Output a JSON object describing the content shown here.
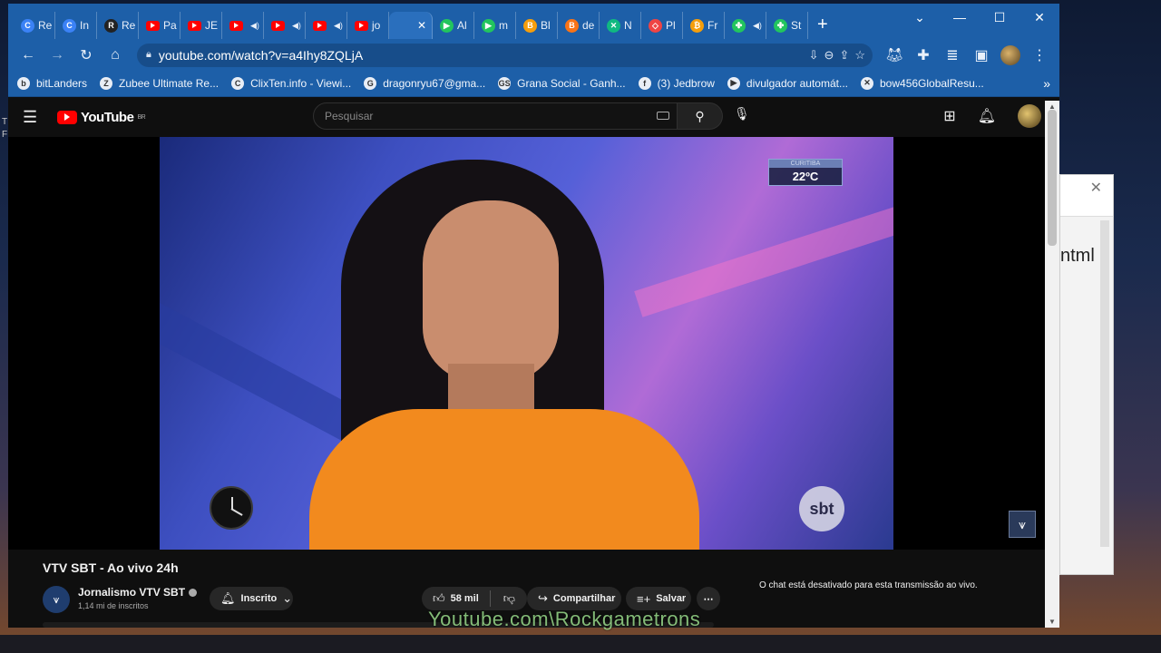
{
  "desktop": {
    "bg_window_text": "ntml",
    "edge_text": "T\nF"
  },
  "tabs": [
    {
      "label": "Re",
      "fav": "C",
      "color": "#3b82f6"
    },
    {
      "label": "In",
      "fav": "C",
      "color": "#3b82f6"
    },
    {
      "label": "Re",
      "fav": "R",
      "color": "#222222"
    },
    {
      "label": "Pa",
      "fav": "yt"
    },
    {
      "label": "JE",
      "fav": "yt"
    },
    {
      "label": "",
      "fav": "yt",
      "audio": true
    },
    {
      "label": "",
      "fav": "yt",
      "audio": true
    },
    {
      "label": "",
      "fav": "yt",
      "audio": true
    },
    {
      "label": "jo",
      "fav": "yt"
    },
    {
      "label": "",
      "fav": "",
      "active": true
    },
    {
      "label": "Al",
      "fav": "▶",
      "color": "#22c55e"
    },
    {
      "label": "m",
      "fav": "▶",
      "color": "#22c55e"
    },
    {
      "label": "Bl",
      "fav": "B",
      "color": "#f59e0b"
    },
    {
      "label": "de",
      "fav": "B",
      "color": "#f97316"
    },
    {
      "label": "N",
      "fav": "✕",
      "color": "#10b981"
    },
    {
      "label": "Pl",
      "fav": "◇",
      "color": "#ef4444"
    },
    {
      "label": "Fr",
      "fav": "₿",
      "color": "#f59e0b"
    },
    {
      "label": "",
      "fav": "✤",
      "color": "#22c55e",
      "audio": true
    },
    {
      "label": "St",
      "fav": "✤",
      "color": "#22c55e"
    }
  ],
  "address": {
    "url": "youtube.com/watch?v=a4Ihy8ZQLjA"
  },
  "bookmarks": [
    {
      "label": "bitLanders",
      "icon": "b"
    },
    {
      "label": "Zubee Ultimate Re...",
      "icon": "Z"
    },
    {
      "label": "ClixTen.info - Viewi...",
      "icon": "C"
    },
    {
      "label": "dragonryu67@gma...",
      "icon": "G"
    },
    {
      "label": "Grana Social - Ganh...",
      "icon": "GS"
    },
    {
      "label": "(3) Jedbrow",
      "icon": "f"
    },
    {
      "label": "divulgador automát...",
      "icon": "▶"
    },
    {
      "label": "bow456GlobalResu...",
      "icon": "✕"
    }
  ],
  "youtube": {
    "logo_text": "YouTube",
    "logo_region": "BR",
    "search_placeholder": "Pesquisar"
  },
  "video": {
    "temp_city": "CURITIBA",
    "temp_value": "22ºC",
    "broadcaster_logo": "sbt",
    "title": "VTV SBT - Ao vivo 24h"
  },
  "channel": {
    "name": "Jornalismo VTV SBT",
    "subscribers": "1,14 mi de inscritos",
    "subscribe_label": "Inscrito"
  },
  "actions": {
    "likes": "58 mil",
    "share_label": "Compartilhar",
    "save_label": "Salvar"
  },
  "chat": {
    "disabled_text": "O chat está desativado para esta transmissão ao vivo."
  },
  "watermark": "Youtube.com\\Rockgametrons"
}
